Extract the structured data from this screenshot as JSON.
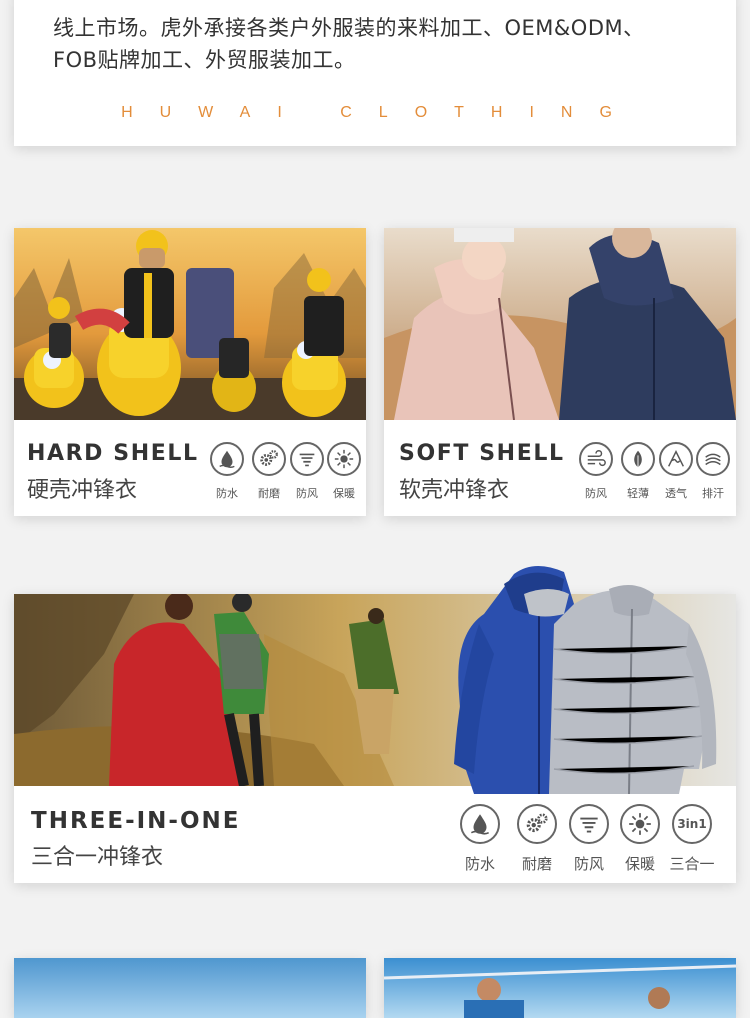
{
  "intro": {
    "line1": "线上市场。虎外承接各类户外服装的来料加工、OEM&ODM、",
    "line2": "FOB贴牌加工、外贸服装加工。",
    "brand": "HUWAI CLOTHING",
    "brand_color": "#e38d3a"
  },
  "hard_shell": {
    "title": "HARD SHELL",
    "subtitle": "硬壳冲锋衣",
    "features": [
      {
        "label": "防水",
        "icon": "water-drop-icon"
      },
      {
        "label": "耐磨",
        "icon": "gears-icon"
      },
      {
        "label": "防风",
        "icon": "wind-icon"
      },
      {
        "label": "保暖",
        "icon": "sun-icon"
      }
    ]
  },
  "soft_shell": {
    "title": "SOFT SHELL",
    "subtitle": "软壳冲锋衣",
    "features": [
      {
        "label": "防风",
        "icon": "wind-icon"
      },
      {
        "label": "轻薄",
        "icon": "feather-icon"
      },
      {
        "label": "透气",
        "icon": "breathable-icon"
      },
      {
        "label": "排汗",
        "icon": "wicking-icon"
      }
    ]
  },
  "three_in_one": {
    "title": "THREE-IN-ONE",
    "subtitle": "三合一冲锋衣",
    "features": [
      {
        "label": "防水",
        "icon": "water-drop-icon"
      },
      {
        "label": "耐磨",
        "icon": "gears-icon"
      },
      {
        "label": "防风",
        "icon": "wind-icon"
      },
      {
        "label": "保暖",
        "icon": "sun-icon"
      },
      {
        "label": "三合一",
        "icon": "three-in-one-icon",
        "icon_text": "3in1"
      }
    ]
  }
}
